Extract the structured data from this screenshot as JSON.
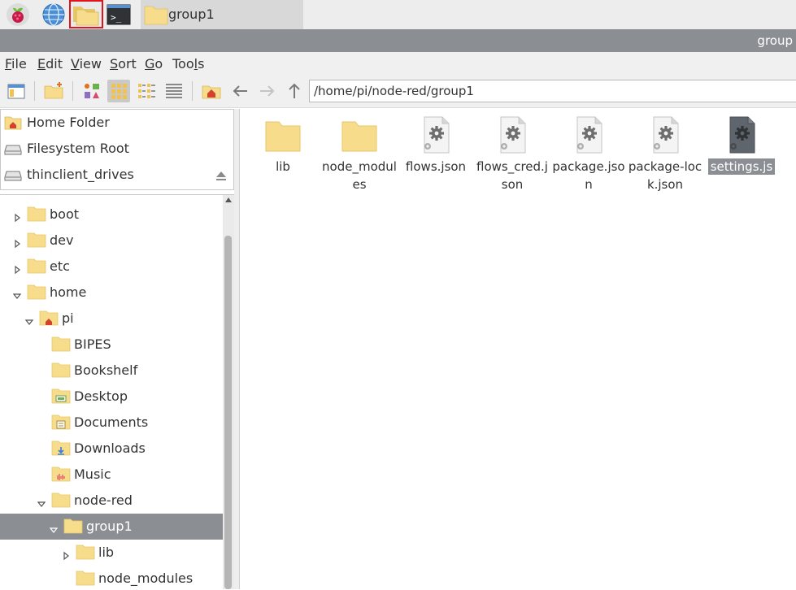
{
  "taskbar": {
    "window_title": "group1"
  },
  "window": {
    "title": "group"
  },
  "menu": [
    "File",
    "Edit",
    "View",
    "Sort",
    "Go",
    "Tools"
  ],
  "path": {
    "value": "/home/pi/node-red/group1"
  },
  "places": [
    {
      "label": "Home Folder",
      "icon": "home-folder-icon"
    },
    {
      "label": "Filesystem Root",
      "icon": "drive-icon"
    },
    {
      "label": "thinclient_drives",
      "icon": "drive-icon"
    }
  ],
  "tree": [
    {
      "label": "boot",
      "level": 0,
      "expander": "collapsed"
    },
    {
      "label": "dev",
      "level": 0,
      "expander": "collapsed"
    },
    {
      "label": "etc",
      "level": 0,
      "expander": "collapsed"
    },
    {
      "label": "home",
      "level": 0,
      "expander": "expanded"
    },
    {
      "label": "pi",
      "level": 1,
      "expander": "expanded",
      "icon": "home-folder-icon"
    },
    {
      "label": "BIPES",
      "level": 2,
      "expander": "none"
    },
    {
      "label": "Bookshelf",
      "level": 2,
      "expander": "none"
    },
    {
      "label": "Desktop",
      "level": 2,
      "expander": "none",
      "icon": "desktop-folder-icon"
    },
    {
      "label": "Documents",
      "level": 2,
      "expander": "none",
      "icon": "documents-folder-icon"
    },
    {
      "label": "Downloads",
      "level": 2,
      "expander": "none",
      "icon": "downloads-folder-icon"
    },
    {
      "label": "Music",
      "level": 2,
      "expander": "none",
      "icon": "music-folder-icon"
    },
    {
      "label": "node-red",
      "level": 2,
      "expander": "expanded"
    },
    {
      "label": "group1",
      "level": 3,
      "expander": "expanded",
      "selected": true
    },
    {
      "label": "lib",
      "level": 4,
      "expander": "collapsed"
    },
    {
      "label": "node_modules",
      "level": 4,
      "expander": "none"
    }
  ],
  "files": [
    {
      "name": "lib",
      "type": "folder"
    },
    {
      "name": "node_modules",
      "type": "folder"
    },
    {
      "name": "flows.json",
      "type": "file"
    },
    {
      "name": "flows_cred.json",
      "type": "file"
    },
    {
      "name": "package.json",
      "type": "file"
    },
    {
      "name": "package-lock.json",
      "type": "file"
    },
    {
      "name": "settings.js",
      "type": "file",
      "selected": true
    }
  ],
  "colors": {
    "folder": "#f7dc8b",
    "folder_edge": "#e7c66a",
    "selection": "#8b8f94",
    "highlight_frame": "#e0141e"
  }
}
